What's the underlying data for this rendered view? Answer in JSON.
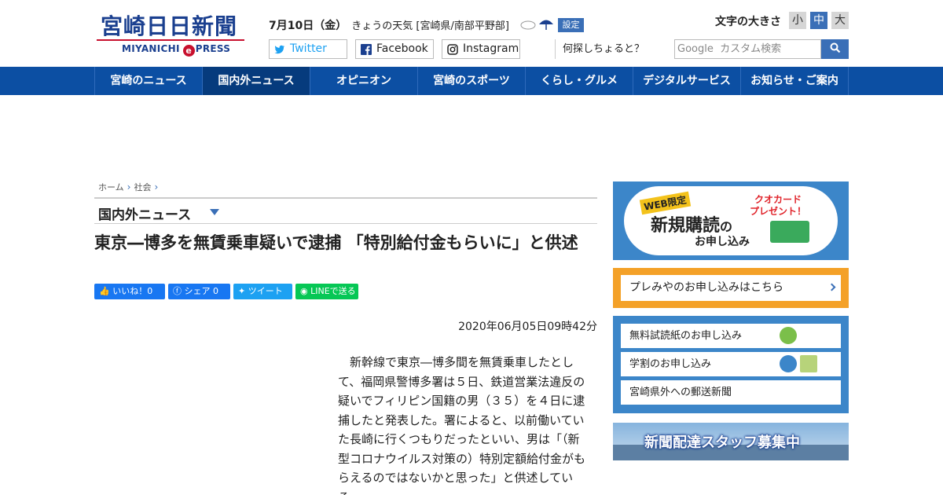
{
  "header": {
    "logo_main": "宮崎日日新聞",
    "logo_sub_left": "MIYANICHI",
    "logo_sub_e": "e",
    "logo_sub_right": "PRESS",
    "date": "7月10日（金）",
    "weather": "きょうの天気 [宮崎県/南部平野部]",
    "settings_label": "設定",
    "font_size_label": "文字の大きさ",
    "font_sizes": [
      "小",
      "中",
      "大"
    ],
    "social": {
      "twitter": "Twitter",
      "facebook": "Facebook",
      "instagram": "Instagram"
    },
    "search_prompt": "何探しちょると？",
    "search_placeholder": "Google  カスタム検索"
  },
  "nav": {
    "items": [
      {
        "label": "宮崎のニュース"
      },
      {
        "label": "国内外ニュース"
      },
      {
        "label": "オピニオン"
      },
      {
        "label": "宮崎のスポーツ"
      },
      {
        "label": "くらし・グルメ"
      },
      {
        "label": "デジタルサービス"
      },
      {
        "label": "お知らせ・ご案内"
      }
    ]
  },
  "article": {
    "breadcrumb": [
      "ホーム",
      "社会"
    ],
    "category": "国内外ニュース",
    "headline": "東京―博多を無賃乗車疑いで逮捕 「特別給付金もらいに」と供述",
    "share": {
      "like": "いいね！0",
      "facebook": "シェア 0",
      "twitter": "ツイート",
      "line": "LINEで送る"
    },
    "published": "2020年06月05日09時42分",
    "body": "新幹線で東京―博多間を無賃乗車したとして、福岡県警博多署は５日、鉄道営業法違反の疑いでフィリピン国籍の男（３５）を４日に逮捕したと発表した。署によると、以前働いていた長崎に行くつもりだったといい、男は「（新型コロナウイルス対策の）特別定額給付金がもらえるのではないかと思った」と供述している。"
  },
  "sidebar": {
    "subscribe_ad": {
      "web_label": "WEB限定",
      "main": "新規購読",
      "main_suffix": "の",
      "apply": "お申し込み",
      "quo_line1": "クオカード",
      "quo_line2": "プレゼント！"
    },
    "premiyaya": "プレみやのお申し込みはこちら",
    "links": [
      {
        "label": "無料試読紙のお申し込み"
      },
      {
        "label": "学割のお申し込み"
      },
      {
        "label": "宮崎県外への郵送新聞"
      }
    ],
    "staff_banner": "新聞配達スタッフ募集中"
  }
}
